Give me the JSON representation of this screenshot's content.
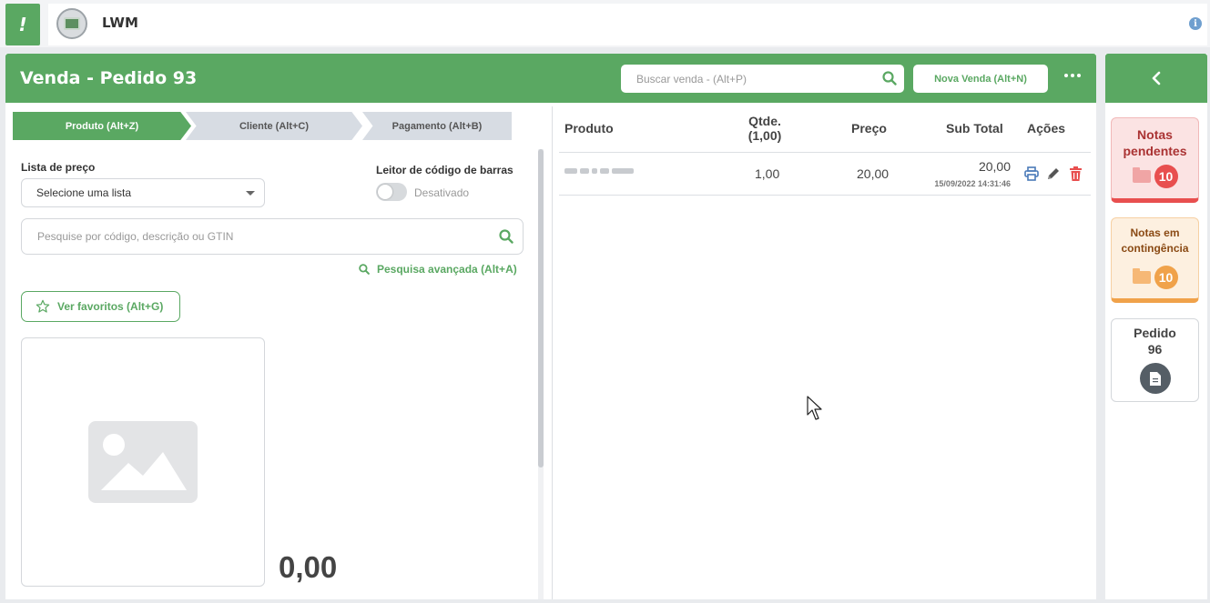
{
  "app": {
    "logo_glyph": "!",
    "company_name": "LWM",
    "info_glyph": "i"
  },
  "header": {
    "title": "Venda - Pedido 93",
    "search_placeholder": "Buscar venda - (Alt+P)",
    "new_sale_label": "Nova Venda  (Alt+N)"
  },
  "steps": [
    {
      "label": "Produto (Alt+Z)",
      "active": true
    },
    {
      "label": "Cliente (Alt+C)",
      "active": false
    },
    {
      "label": "Pagamento (Alt+B)",
      "active": false
    }
  ],
  "form": {
    "price_list_label": "Lista de preço",
    "price_list_value": "Selecione uma lista",
    "barcode_label": "Leitor de código de barras",
    "barcode_state": "Desativado",
    "product_search_placeholder": "Pesquise por código, descrição ou GTIN",
    "advanced_search_label": "Pesquisa avançada (Alt+A)",
    "favorites_label": "Ver favoritos (Alt+G)",
    "price_display": "0,00"
  },
  "table": {
    "headers": {
      "produto": "Produto",
      "qtde_line1": "Qtde.",
      "qtde_line2": "(1,00)",
      "preco": "Preço",
      "subtotal": "Sub Total",
      "acoes": "Ações"
    },
    "rows": [
      {
        "qtde": "1,00",
        "preco": "20,00",
        "subtotal": "20,00",
        "timestamp": "15/09/2022 14:31:46"
      }
    ]
  },
  "sidebar": {
    "pending": {
      "title_line1": "Notas",
      "title_line2": "pendentes",
      "count": "10"
    },
    "contingency": {
      "title_line1": "Notas em",
      "title_line2": "contingência",
      "count": "10"
    },
    "order": {
      "title_line1": "Pedido",
      "title_line2": "96"
    }
  },
  "colors": {
    "brand": "#5aa862",
    "danger": "#e84f4f",
    "warning": "#f0a24a",
    "print": "#4a7ab8"
  }
}
